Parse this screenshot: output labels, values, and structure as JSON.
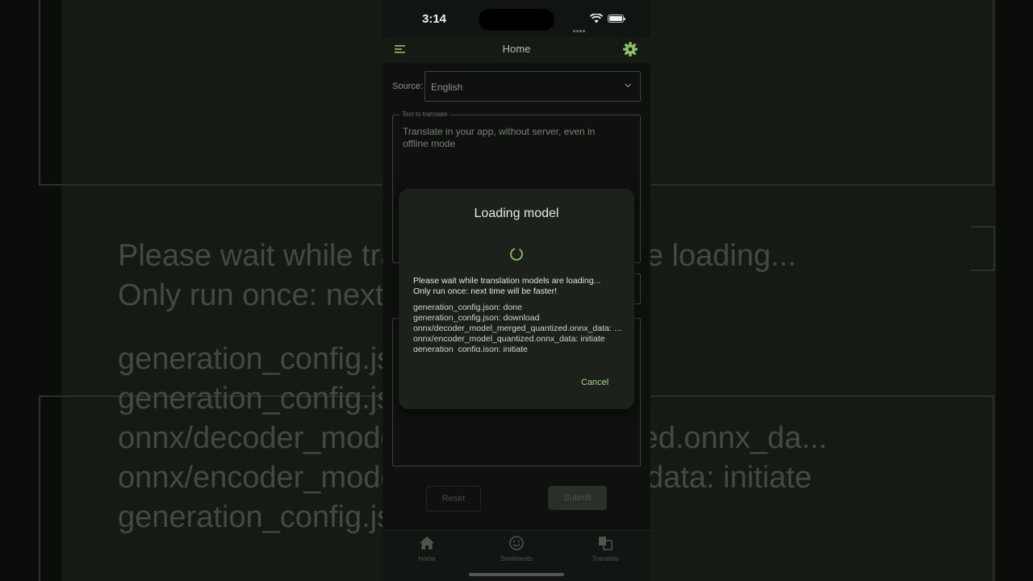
{
  "status_bar": {
    "time": "3:14"
  },
  "app_bar": {
    "title": "Home",
    "menu_icon": "menu-icon",
    "settings_icon": "gear-icon"
  },
  "source": {
    "label": "Source:",
    "value": "English"
  },
  "text_field": {
    "legend": "Text to translate",
    "placeholder": "Translate in your app, without server, even in offline mode"
  },
  "buttons": {
    "reset": "Reset",
    "submit": "Submit"
  },
  "tabs": [
    {
      "label": "Home",
      "icon": "home-icon"
    },
    {
      "label": "Sentiments",
      "icon": "smile-icon"
    },
    {
      "label": "Translate",
      "icon": "translate-icon"
    }
  ],
  "dialog": {
    "title": "Loading model",
    "message_line1": "Please wait while translation models are loading...",
    "message_line2": "Only run once: next time will be faster!",
    "log": [
      "generation_config.json: done",
      "generation_config.json: download",
      "onnx/decoder_model_merged_quantized.onnx_data: initiate",
      "onnx/encoder_model_quantized.onnx_data: initiate",
      "generation_config.json: initiate"
    ],
    "cancel": "Cancel"
  },
  "background": {
    "line1": "Please wait while translation models are loading...",
    "line2": "Only run once: next time will be faster!",
    "log1": "generation_config.json: done",
    "log2": "generation_config.json: download",
    "log3": "onnx/decoder_model_merged_quantized.onnx_da...",
    "log4": "onnx/encoder_model_quantized.onnx_data: initiate",
    "log5": "generation_config.json: initiate"
  },
  "colors": {
    "accent": "#8fbf6a",
    "background": "#0e110e",
    "dialog": "#1c221b"
  }
}
